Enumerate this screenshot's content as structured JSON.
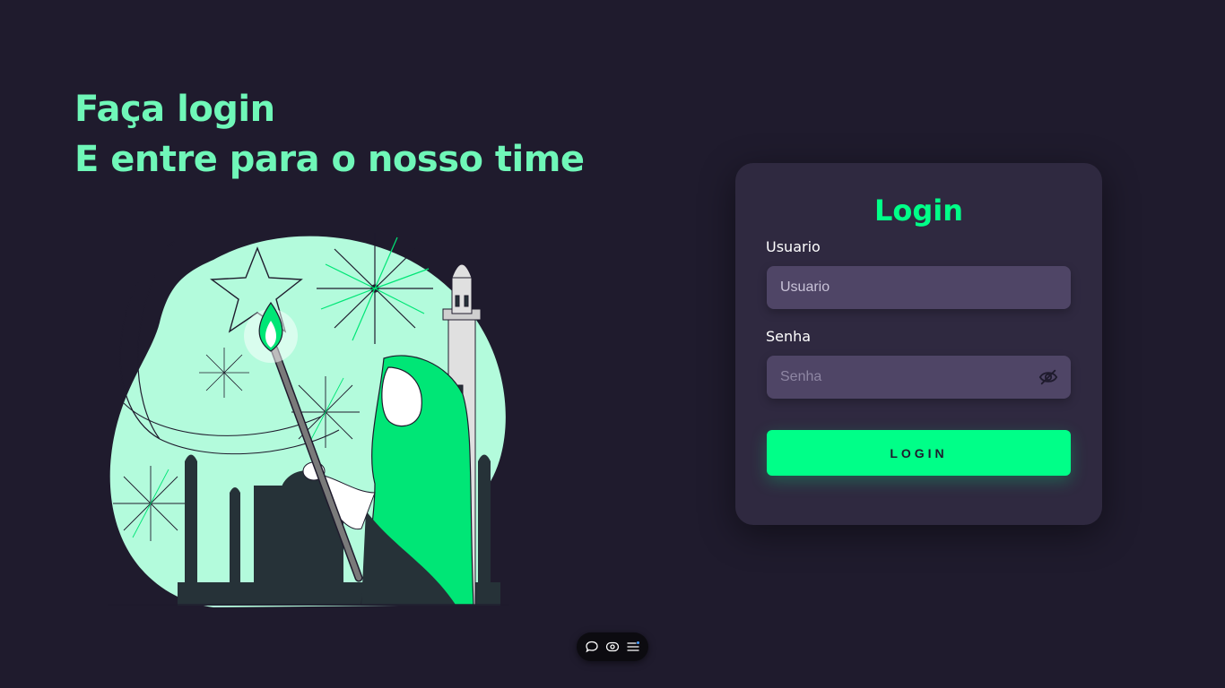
{
  "hero": {
    "line1": "Faça login",
    "line2": "E entre para o nosso time"
  },
  "login_card": {
    "title": "Login",
    "username": {
      "label": "Usuario",
      "placeholder": "Usuario",
      "value": ""
    },
    "password": {
      "label": "Senha",
      "placeholder": "Senha",
      "value": ""
    },
    "submit_label": "LOGIN"
  },
  "toolbar": {
    "icons": [
      "comment-icon",
      "eye-toggle-icon",
      "menu-icon"
    ]
  },
  "colors": {
    "background": "#1f1b2d",
    "card": "#2f2940",
    "input": "#4f4566",
    "accent": "#00ff88",
    "headline": "#6ff7b8"
  }
}
